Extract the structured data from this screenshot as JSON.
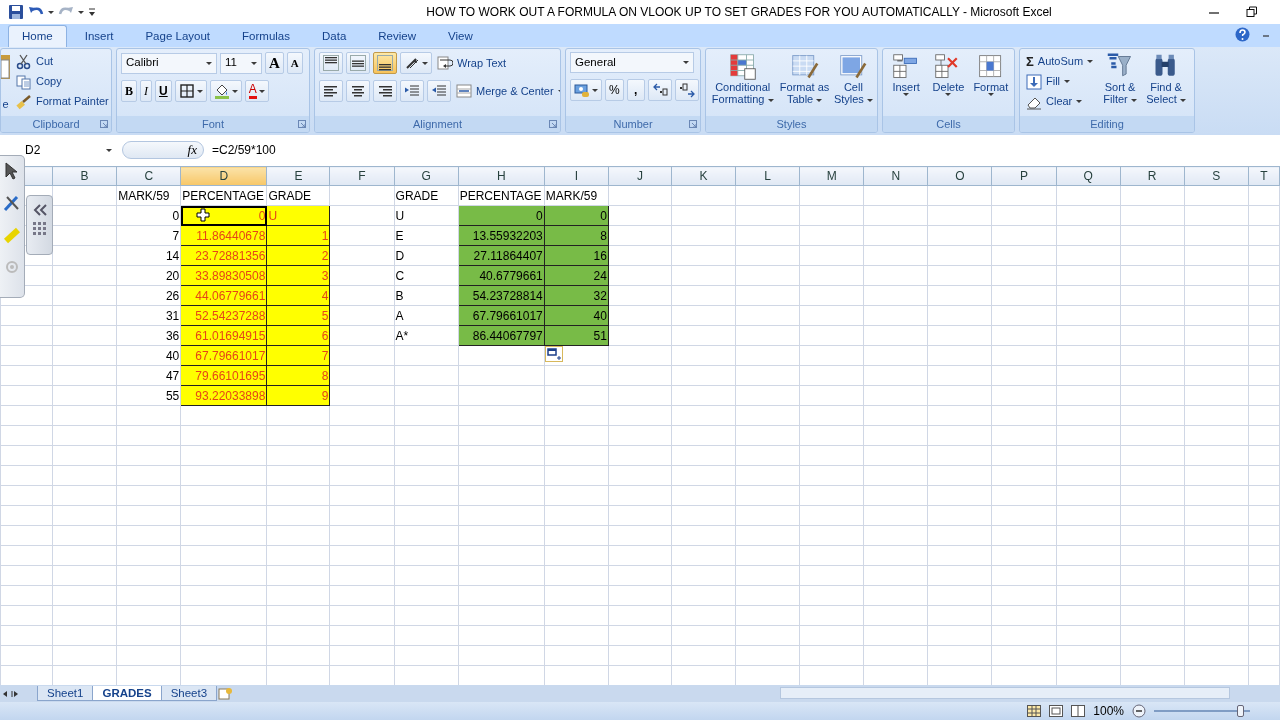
{
  "window": {
    "title": "HOW TO WORK OUT A FORMULA ON VLOOK UP TO SET GRADES FOR YOU AUTOMATICALLY - Microsoft Excel"
  },
  "tabs": [
    {
      "label": "Home",
      "selected": true
    },
    {
      "label": "Insert",
      "selected": false
    },
    {
      "label": "Page Layout",
      "selected": false
    },
    {
      "label": "Formulas",
      "selected": false
    },
    {
      "label": "Data",
      "selected": false
    },
    {
      "label": "Review",
      "selected": false
    },
    {
      "label": "View",
      "selected": false
    }
  ],
  "ribbon": {
    "groups": [
      {
        "label": "Clipboard",
        "buttons": [
          {
            "label": "e"
          },
          {
            "label": "Cut"
          },
          {
            "label": "Copy"
          },
          {
            "label": "Format Painter"
          }
        ]
      },
      {
        "label": "Font",
        "font": "Calibri",
        "size": "11",
        "buttons": [
          {
            "label": "A"
          },
          {
            "label": "A"
          },
          {
            "label": "B"
          },
          {
            "label": "I"
          },
          {
            "label": "U"
          },
          {
            "label": "A"
          }
        ]
      },
      {
        "label": "Alignment",
        "bottom_aligned": true,
        "buttons": [
          {
            "label": "Wrap Text"
          },
          {
            "label": "Merge & Center"
          }
        ]
      },
      {
        "label": "Number",
        "format": "General",
        "buttons": [
          {
            "label": "%"
          },
          {
            "label": ","
          }
        ]
      },
      {
        "label": "Styles",
        "buttons": [
          {
            "label": "Conditional Formatting"
          },
          {
            "label": "Format as Table"
          },
          {
            "label": "Cell Styles"
          }
        ]
      },
      {
        "label": "Cells",
        "buttons": [
          {
            "label": "Insert"
          },
          {
            "label": "Delete"
          },
          {
            "label": "Format"
          }
        ]
      },
      {
        "label": "Editing",
        "symbol": "Σ",
        "buttons": [
          {
            "label": "AutoSum"
          },
          {
            "label": "Fill"
          },
          {
            "label": "Clear"
          },
          {
            "label": "Sort & Filter"
          },
          {
            "label": "Find & Select"
          }
        ]
      }
    ]
  },
  "formula_bar": {
    "name_box": "D2",
    "fx": "fx",
    "formula": "=C2/59*100"
  },
  "columns": [
    {
      "label": "B",
      "selected": false
    },
    {
      "label": "C",
      "selected": false
    },
    {
      "label": "D",
      "selected": true
    },
    {
      "label": "E",
      "selected": false
    },
    {
      "label": "F",
      "selected": false
    },
    {
      "label": "G",
      "selected": false
    },
    {
      "label": "H",
      "selected": false
    },
    {
      "label": "I",
      "selected": false
    },
    {
      "label": "J",
      "selected": false
    },
    {
      "label": "K",
      "selected": false
    },
    {
      "label": "L",
      "selected": false
    },
    {
      "label": "M",
      "selected": false
    },
    {
      "label": "N",
      "selected": false
    },
    {
      "label": "O",
      "selected": false
    },
    {
      "label": "P",
      "selected": false
    },
    {
      "label": "Q",
      "selected": false
    },
    {
      "label": "R",
      "selected": false
    },
    {
      "label": "S",
      "selected": false
    },
    {
      "label": "T",
      "selected": false
    }
  ],
  "rows": [
    {
      "cells": [
        {
          "kind": "empty"
        },
        {
          "kind": "label",
          "text": "MARK/59",
          "selected": false
        },
        {
          "kind": "label",
          "text": "PERCENTAGE",
          "selected": false
        },
        {
          "kind": "label",
          "text": "GRADE",
          "selected": false
        },
        {
          "kind": "empty"
        },
        {
          "kind": "label",
          "text": "GRADE",
          "selected": false
        },
        {
          "kind": "label",
          "text": "PERCENTAGE",
          "selected": false
        },
        {
          "kind": "label",
          "text": "MARK/59",
          "selected": false
        }
      ]
    },
    {
      "cells": [
        {
          "kind": "empty"
        },
        {
          "kind": "number",
          "text": "0",
          "selected": false
        },
        {
          "kind": "result",
          "text": "0",
          "selected": true
        },
        {
          "kind": "result-text",
          "text": "U",
          "selected": false
        },
        {
          "kind": "empty"
        },
        {
          "kind": "label",
          "text": "U",
          "selected": false
        },
        {
          "kind": "lookup",
          "text": "0",
          "selected": false
        },
        {
          "kind": "lookup",
          "text": "0",
          "selected": false
        }
      ]
    },
    {
      "cells": [
        {
          "kind": "empty"
        },
        {
          "kind": "number",
          "text": "7",
          "selected": false
        },
        {
          "kind": "result",
          "text": "11.86440678",
          "selected": false
        },
        {
          "kind": "result",
          "text": "1",
          "selected": false
        },
        {
          "kind": "empty"
        },
        {
          "kind": "label",
          "text": "E",
          "selected": false
        },
        {
          "kind": "lookup",
          "text": "13.55932203",
          "selected": false
        },
        {
          "kind": "lookup",
          "text": "8",
          "selected": false
        }
      ]
    },
    {
      "cells": [
        {
          "kind": "empty"
        },
        {
          "kind": "number",
          "text": "14",
          "selected": false
        },
        {
          "kind": "result",
          "text": "23.72881356",
          "selected": false
        },
        {
          "kind": "result",
          "text": "2",
          "selected": false
        },
        {
          "kind": "empty"
        },
        {
          "kind": "label",
          "text": "D",
          "selected": false
        },
        {
          "kind": "lookup",
          "text": "27.11864407",
          "selected": false
        },
        {
          "kind": "lookup",
          "text": "16",
          "selected": false
        }
      ]
    },
    {
      "cells": [
        {
          "kind": "empty"
        },
        {
          "kind": "number",
          "text": "20",
          "selected": false
        },
        {
          "kind": "result",
          "text": "33.89830508",
          "selected": false
        },
        {
          "kind": "result",
          "text": "3",
          "selected": false
        },
        {
          "kind": "empty"
        },
        {
          "kind": "label",
          "text": "C",
          "selected": false
        },
        {
          "kind": "lookup",
          "text": "40.6779661",
          "selected": false
        },
        {
          "kind": "lookup",
          "text": "24",
          "selected": false
        }
      ]
    },
    {
      "cells": [
        {
          "kind": "empty"
        },
        {
          "kind": "number",
          "text": "26",
          "selected": false
        },
        {
          "kind": "result",
          "text": "44.06779661",
          "selected": false
        },
        {
          "kind": "result",
          "text": "4",
          "selected": false
        },
        {
          "kind": "empty"
        },
        {
          "kind": "label",
          "text": "B",
          "selected": false
        },
        {
          "kind": "lookup",
          "text": "54.23728814",
          "selected": false
        },
        {
          "kind": "lookup",
          "text": "32",
          "selected": false
        }
      ]
    },
    {
      "cells": [
        {
          "kind": "empty"
        },
        {
          "kind": "number",
          "text": "31",
          "selected": false
        },
        {
          "kind": "result",
          "text": "52.54237288",
          "selected": false
        },
        {
          "kind": "result",
          "text": "5",
          "selected": false
        },
        {
          "kind": "empty"
        },
        {
          "kind": "label",
          "text": "A",
          "selected": false
        },
        {
          "kind": "lookup",
          "text": "67.79661017",
          "selected": false
        },
        {
          "kind": "lookup",
          "text": "40",
          "selected": false
        }
      ]
    },
    {
      "cells": [
        {
          "kind": "empty"
        },
        {
          "kind": "number",
          "text": "36",
          "selected": false
        },
        {
          "kind": "result",
          "text": "61.01694915",
          "selected": false
        },
        {
          "kind": "result",
          "text": "6",
          "selected": false
        },
        {
          "kind": "empty"
        },
        {
          "kind": "label",
          "text": "A*",
          "selected": false
        },
        {
          "kind": "lookup",
          "text": "86.44067797",
          "selected": false
        },
        {
          "kind": "lookup",
          "text": "51",
          "selected": false
        }
      ]
    },
    {
      "cells": [
        {
          "kind": "empty"
        },
        {
          "kind": "number",
          "text": "40",
          "selected": false
        },
        {
          "kind": "result",
          "text": "67.79661017",
          "selected": false
        },
        {
          "kind": "result",
          "text": "7",
          "selected": false
        },
        {
          "kind": "empty"
        },
        {
          "kind": "empty"
        },
        {
          "kind": "empty"
        },
        {
          "kind": "empty"
        }
      ]
    },
    {
      "cells": [
        {
          "kind": "empty"
        },
        {
          "kind": "number",
          "text": "47",
          "selected": false
        },
        {
          "kind": "result",
          "text": "79.66101695",
          "selected": false
        },
        {
          "kind": "result",
          "text": "8",
          "selected": false
        },
        {
          "kind": "empty"
        },
        {
          "kind": "empty"
        },
        {
          "kind": "empty"
        },
        {
          "kind": "empty"
        }
      ]
    },
    {
      "cells": [
        {
          "kind": "empty"
        },
        {
          "kind": "number",
          "text": "55",
          "selected": false
        },
        {
          "kind": "result",
          "text": "93.22033898",
          "selected": false
        },
        {
          "kind": "result",
          "text": "9",
          "selected": false
        },
        {
          "kind": "empty"
        },
        {
          "kind": "empty"
        },
        {
          "kind": "empty"
        },
        {
          "kind": "empty"
        }
      ]
    }
  ],
  "sheet_tabs": [
    {
      "label": "Sheet1",
      "selected": false
    },
    {
      "label": "GRADES",
      "selected": true
    },
    {
      "label": "Sheet3",
      "selected": false
    }
  ],
  "status_bar": {
    "zoom": "100%",
    "level": 0.9
  }
}
